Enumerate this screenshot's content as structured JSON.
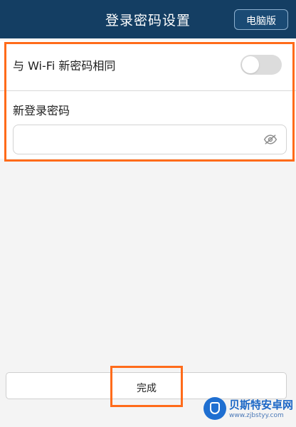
{
  "header": {
    "title": "登录密码设置",
    "pc_version_label": "电脑版"
  },
  "settings": {
    "same_as_wifi_label": "与 Wi-Fi 新密码相同",
    "toggle_state": "off",
    "new_password_label": "新登录密码",
    "password_value": "",
    "password_placeholder": ""
  },
  "footer": {
    "done_label": "完成"
  },
  "watermark": {
    "text": "贝斯特安卓网",
    "url": "www.zjbstyy.com"
  },
  "colors": {
    "header_bg": "#143e63",
    "highlight": "#ff6b1a",
    "toggle_off": "#dcdcdc",
    "watermark_blue": "#1c67c6"
  },
  "icons": {
    "password_visibility": "eye-off-icon",
    "watermark_logo": "shield-icon"
  }
}
